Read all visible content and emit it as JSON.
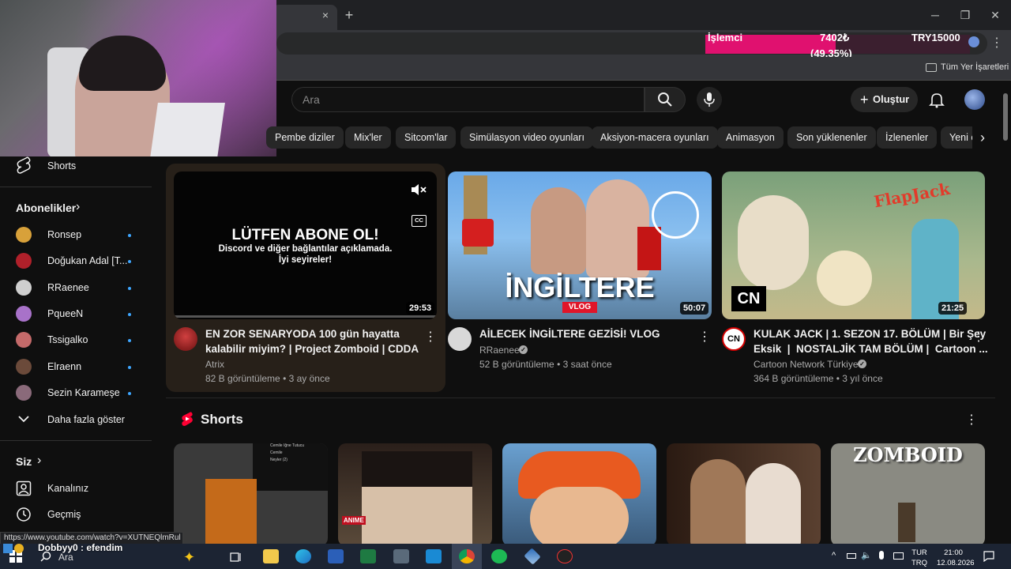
{
  "browser": {
    "tab_close": "×",
    "new_tab": "+",
    "win_min": "─",
    "win_max": "❐",
    "win_close": "✕",
    "bookmarks_label": "Tüm Yer İşaretleri",
    "menu": "⋮"
  },
  "donation_overlay": {
    "label": "İşlemci",
    "amount": "7402₺",
    "percent_text": "(49.35%)",
    "goal": "TRY15000",
    "progress": 0.4935,
    "fill_color": "#e0116f"
  },
  "header": {
    "search_placeholder": "Ara",
    "create_label": "Oluştur",
    "create_plus": "+"
  },
  "chips": [
    "Pembe diziler",
    "Mix'ler",
    "Sitcom'lar",
    "Simülasyon video oyunları",
    "Aksiyon-macera oyunları",
    "Animasyon",
    "Son yüklenenler",
    "İzlenenler",
    "Yeni ö"
  ],
  "chip_next": "›",
  "sidebar": {
    "shorts": "Shorts",
    "subscriptions_heading": "Abonelikler",
    "chevron": "›",
    "subscriptions": [
      {
        "name": "Ronsep",
        "color": "#d8a13a"
      },
      {
        "name": "Doğukan Adal [T...",
        "color": "#b0202a"
      },
      {
        "name": "RRaenee",
        "color": "#cfcfcf"
      },
      {
        "name": "PqueeN",
        "color": "#a872c9"
      },
      {
        "name": "Tssigalko",
        "color": "#c46a6a"
      },
      {
        "name": "Elraenn",
        "color": "#6b4a3a"
      },
      {
        "name": "Sezin Karameşe",
        "color": "#8a6a7a"
      }
    ],
    "show_more": "Daha fazla göster",
    "you_heading": "Siz",
    "channel": "Kanalınız",
    "history": "Geçmiş"
  },
  "videos": [
    {
      "thumb_line1": "LÜTFEN ABONE OL!",
      "thumb_line2": "Discord ve diğer bağlantılar açıklamada.",
      "thumb_line3": "İyi seyireler!",
      "duration": "29:53",
      "title_line1": "EN ZOR SENARYODA 100 gün hayatta",
      "title_line2": "kalabilir miyim? | Project Zomboid | CDDA",
      "channel": "Atrix",
      "meta": "82 B görüntüleme • 3 ay önce",
      "cc": "CC"
    },
    {
      "thumb_text": "İNGİLTERE",
      "thumb_badge": "VLOG",
      "duration": "50:07",
      "title_line1": "AİLECEK İNGİLTERE GEZİSİ! VLOG",
      "title_line2": "",
      "channel": "RRaenee",
      "verified": "✓",
      "meta": "52 B görüntüleme • 3 saat önce"
    },
    {
      "thumb_text": "FlapJack",
      "thumb_logo": "CN",
      "duration": "21:25",
      "title_line1": "KULAK JACK | 1. SEZON 17. BÖLÜM | Bir Şey",
      "title_line2": "Eksik  |  NOSTALJİK TAM BÖLÜM |  Cartoon ...",
      "channel": "Cartoon Network Türkiye",
      "verified": "✓",
      "meta": "364 B görüntüleme • 3 yıl önce",
      "avatar_text": "CN"
    }
  ],
  "shorts_section": {
    "title": "Shorts",
    "short1_menu": [
      "Cemile İğne Tutucu",
      "Cemile",
      "Neyler (2)"
    ],
    "short2_text": "ANIME",
    "short5_text": "ZOMBOID"
  },
  "status_url": "https://www.youtube.com/watch?v=XUTNEQlmRul",
  "chat_message": "Dobbyy0 : efendim",
  "taskbar": {
    "search": "Ara",
    "lang1": "TUR",
    "lang2": "TRQ",
    "time": "21:00",
    "date": "12.08.2026"
  }
}
